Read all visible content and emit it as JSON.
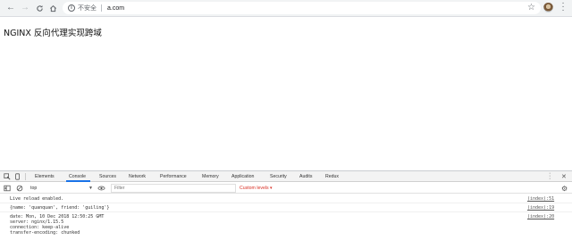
{
  "browser": {
    "url": "a.com",
    "security_label": "不安全"
  },
  "page": {
    "title": "NGINX 反向代理实现跨域"
  },
  "devtools": {
    "tabs": [
      "Elements",
      "Console",
      "Sources",
      "Network",
      "Performance",
      "Memory",
      "Application",
      "Security",
      "Audits",
      "Redux"
    ],
    "active_tab": "Console",
    "context": "top",
    "filter_placeholder": "Filter",
    "levels_label": "Custom levels ▾",
    "messages": [
      {
        "text": "Live reload enabled.",
        "source": "(index):51"
      },
      {
        "text": "{name: 'quanquan', friend: 'guiling'}",
        "source": "(index):19"
      },
      {
        "lines": [
          "date: Mon, 10 Dec 2018 12:50:25 GMT",
          "server: nginx/1.15.5",
          "connection: keep-alive",
          "transfer-encoding: chunked"
        ],
        "source": "(index):20"
      }
    ]
  }
}
